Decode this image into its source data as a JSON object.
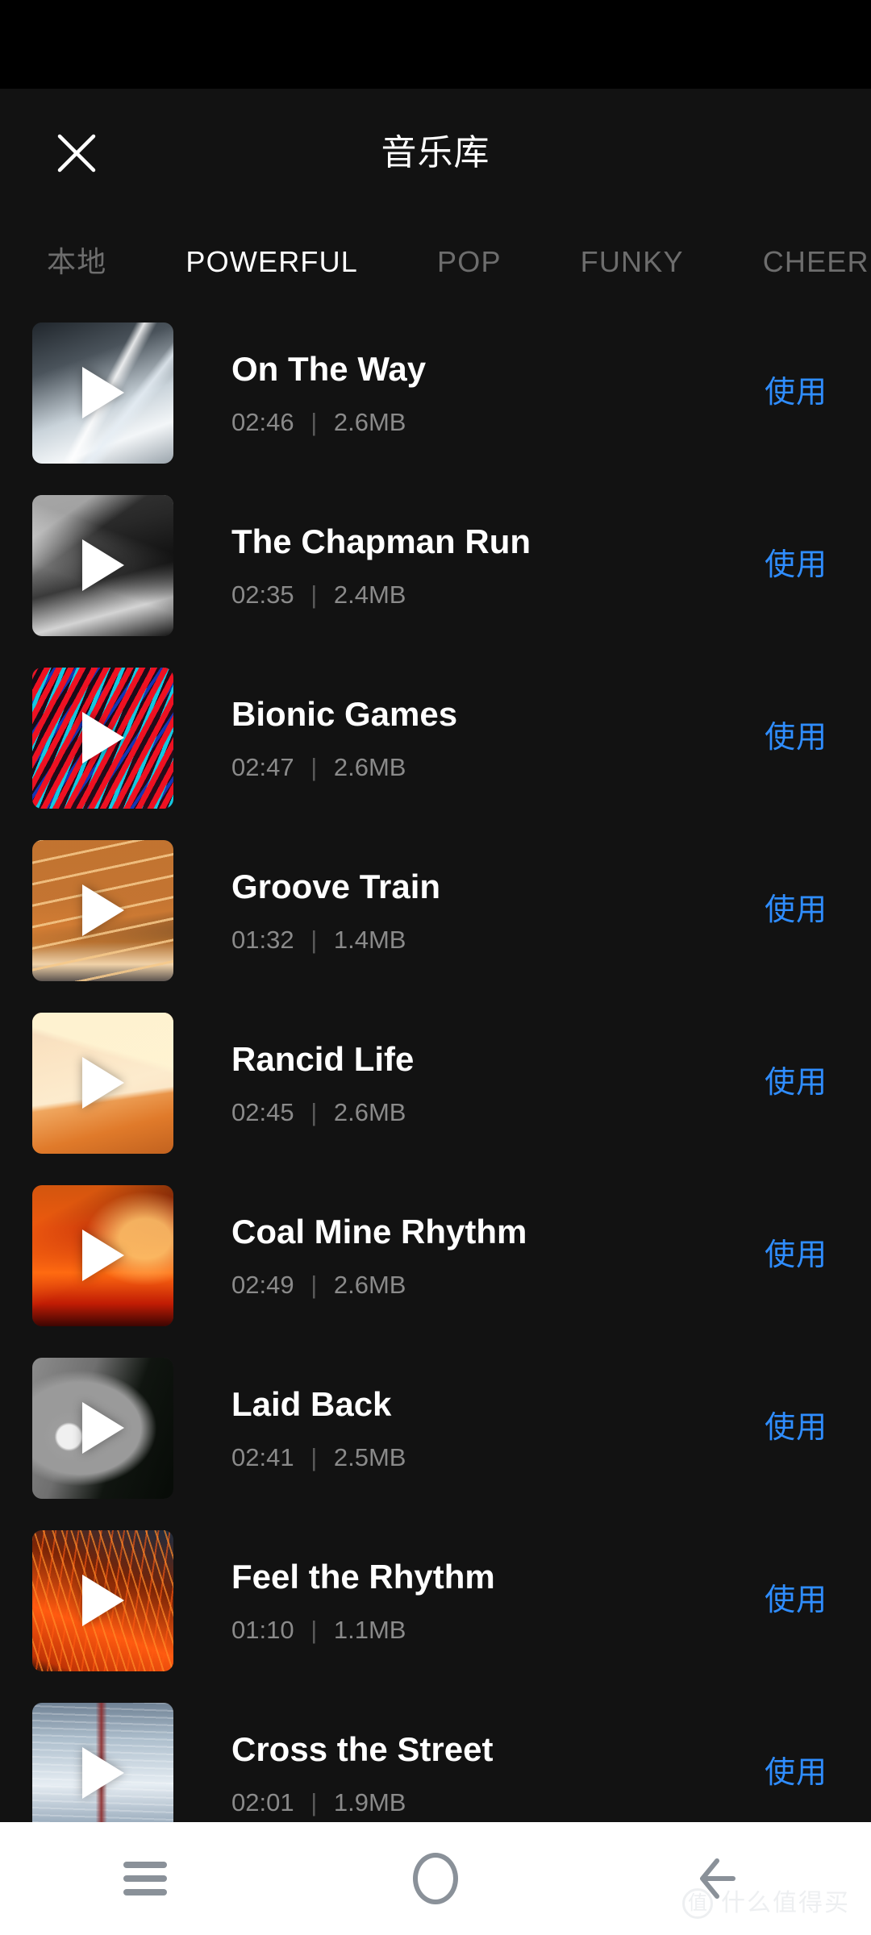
{
  "header": {
    "title": "音乐库",
    "close_icon": "close-icon"
  },
  "tabs": [
    {
      "label": "本地",
      "active": false
    },
    {
      "label": "POWERFUL",
      "active": true
    },
    {
      "label": "POP",
      "active": false
    },
    {
      "label": "FUNKY",
      "active": false
    },
    {
      "label": "CHEERFUL",
      "active": false
    }
  ],
  "list": {
    "separator": "|",
    "action_label": "使用",
    "tracks": [
      {
        "title": "On The Way",
        "duration": "02:46",
        "size": "2.6MB",
        "action": "使用",
        "thumb_desc": "highway-motion-blur",
        "colors": [
          "#dfe4e8",
          "#8d959c",
          "#2e3338",
          "#f2f4f6"
        ]
      },
      {
        "title": "The Chapman Run",
        "duration": "02:35",
        "size": "2.4MB",
        "action": "使用",
        "thumb_desc": "grayscale-mountain-peak",
        "colors": [
          "#d8d8d8",
          "#7a7a7a",
          "#171717",
          "#bdbdbd"
        ]
      },
      {
        "title": "Bionic Games",
        "duration": "02:47",
        "size": "2.6MB",
        "action": "使用",
        "thumb_desc": "red-cyan-light-streaks",
        "colors": [
          "#ee1122",
          "#15c8e0",
          "#1536b4",
          "#ff3355"
        ]
      },
      {
        "title": "Groove Train",
        "duration": "01:32",
        "size": "1.4MB",
        "action": "使用",
        "thumb_desc": "orange-light-trails-night",
        "colors": [
          "#1c1a18",
          "#e08436",
          "#f6c98a",
          "#2b2724"
        ]
      },
      {
        "title": "Rancid Life",
        "duration": "02:45",
        "size": "2.6MB",
        "action": "使用",
        "thumb_desc": "orange-lightning-storm",
        "colors": [
          "#e8852f",
          "#f6c27a",
          "#b14f1c",
          "#fff0c8"
        ]
      },
      {
        "title": "Coal Mine Rhythm",
        "duration": "02:49",
        "size": "2.6MB",
        "action": "使用",
        "thumb_desc": "flaming-guitar",
        "colors": [
          "#d91a08",
          "#ff6a11",
          "#3c0502",
          "#ffb33a"
        ]
      },
      {
        "title": "Laid Back",
        "duration": "02:41",
        "size": "2.5MB",
        "action": "使用",
        "thumb_desc": "grey-vinyl-disc",
        "colors": [
          "#8c8c8c",
          "#c9c9c9",
          "#0d0f0c",
          "#5d5d5d"
        ]
      },
      {
        "title": "Feel the Rhythm",
        "duration": "01:10",
        "size": "1.1MB",
        "action": "使用",
        "thumb_desc": "orange-sparks-steel-wool",
        "colors": [
          "#ff5a10",
          "#b42c05",
          "#1b2c40",
          "#ffa843"
        ]
      },
      {
        "title": "Cross the Street",
        "duration": "02:01",
        "size": "1.9MB",
        "action": "使用",
        "thumb_desc": "blue-subway-tunnel",
        "colors": [
          "#b9c6d4",
          "#5d7388",
          "#e8eef4",
          "#8d2a2a"
        ]
      }
    ]
  },
  "nav_bar": {
    "buttons": [
      {
        "name": "recents-button",
        "icon": "hamburger-icon"
      },
      {
        "name": "home-button",
        "icon": "circle-icon"
      },
      {
        "name": "back-button",
        "icon": "back-arrow-icon"
      }
    ]
  },
  "watermark": {
    "badge": "值",
    "text": "什么值得买"
  },
  "colors": {
    "background": "#121212",
    "status_bar": "#000000",
    "accent_blue": "#2f8dff",
    "title_text": "#ffffff",
    "meta_text": "#8a8a8a",
    "tab_inactive": "#6d6d6d",
    "nav_bar": "#ffffff",
    "nav_icon": "#8a9199"
  }
}
